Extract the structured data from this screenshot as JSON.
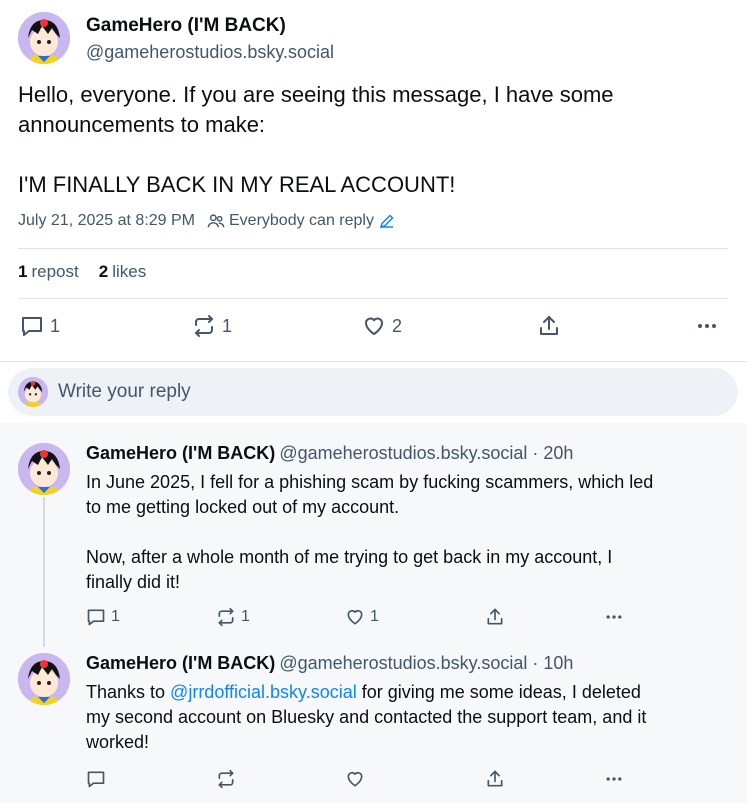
{
  "post": {
    "author_name": "GameHero (I'M BACK)",
    "author_handle": "@gameherostudios.bsky.social",
    "text_line1": "Hello, everyone. If you are seeing this message, I have some",
    "text_line2": "announcements to make:",
    "text_line3": "I'M FINALLY BACK IN MY REAL ACCOUNT!",
    "timestamp": "July 21, 2025 at 8:29 PM",
    "reply_setting": "Everybody can reply",
    "stats": {
      "reposts_num": "1",
      "reposts_label": "repost",
      "likes_num": "2",
      "likes_label": "likes"
    },
    "actions": {
      "reply_count": "1",
      "repost_count": "1",
      "like_count": "2"
    }
  },
  "composer": {
    "placeholder": "Write your reply"
  },
  "replies": [
    {
      "author_name": "GameHero (I'M BACK)",
      "author_handle": "@gameherostudios.bsky.social · 20h",
      "line1": "In June 2025, I fell for a phishing scam by fucking scammers, which led",
      "line2": "to me getting locked out of my account.",
      "line3": "Now, after a whole month of me trying to get back in my account, I",
      "line4": "finally did it!",
      "reply_count": "1",
      "repost_count": "1",
      "like_count": "1"
    },
    {
      "author_name": "GameHero (I'M BACK)",
      "author_handle": "@gameherostudios.bsky.social · 10h",
      "line1_pre": "Thanks to ",
      "mention": "@jrrdofficial.bsky.social",
      "line1_post": " for giving me some ideas, I deleted",
      "line2": "my second account on Bluesky and contacted the support team, and it",
      "line3": "worked!"
    }
  ],
  "colors": {
    "text": "#0b0f14",
    "muted": "#42576c",
    "link": "#1083fe",
    "avatar_bg": "#c8b8ef"
  },
  "icons": [
    "reply-icon",
    "repost-icon",
    "like-icon",
    "share-icon",
    "more-icon",
    "people-icon",
    "pencil-icon"
  ]
}
